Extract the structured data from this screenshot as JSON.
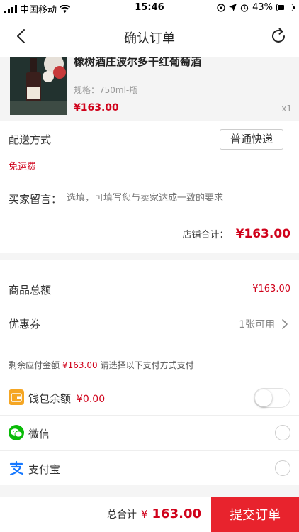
{
  "status_bar": {
    "carrier": "中国移动",
    "time": "15:46",
    "battery": "43%"
  },
  "nav": {
    "title": "确认订单"
  },
  "product": {
    "name": "橡树酒庄波尔多干红葡萄酒",
    "spec": "规格：750ml-瓶",
    "price": "¥163.00",
    "quantity": "x1"
  },
  "shop": {
    "shipping_label": "配送方式",
    "shipping_option": "普通快递",
    "free_shipping": "免运费",
    "message_label": "买家留言：",
    "message_placeholder": "选填，可填写您与卖家达成一致的要求",
    "subtotal_label": "店铺合计：",
    "subtotal_amount": "¥163.00"
  },
  "summary": {
    "goods_total_label": "商品总额",
    "goods_total_value": "¥163.00",
    "coupon_label": "优惠券",
    "coupon_value": "1张可用",
    "remaining_prefix": "剩余应付金额",
    "remaining_amount": "¥163.00",
    "remaining_suffix": "请选择以下支付方式支付"
  },
  "payment": {
    "wallet_label": "钱包余额",
    "wallet_amount": "¥0.00",
    "wechat_label": "微信",
    "alipay_label": "支付宝"
  },
  "bottom": {
    "total_label": "总合计",
    "currency": "¥",
    "total_amount": "163.00",
    "submit_label": "提交订单"
  },
  "colors": {
    "accent": "#e8232d",
    "price_red": "#d0021b",
    "wechat_green": "#09bb07",
    "alipay_blue": "#1678ff",
    "wallet_orange": "#f5a623"
  }
}
